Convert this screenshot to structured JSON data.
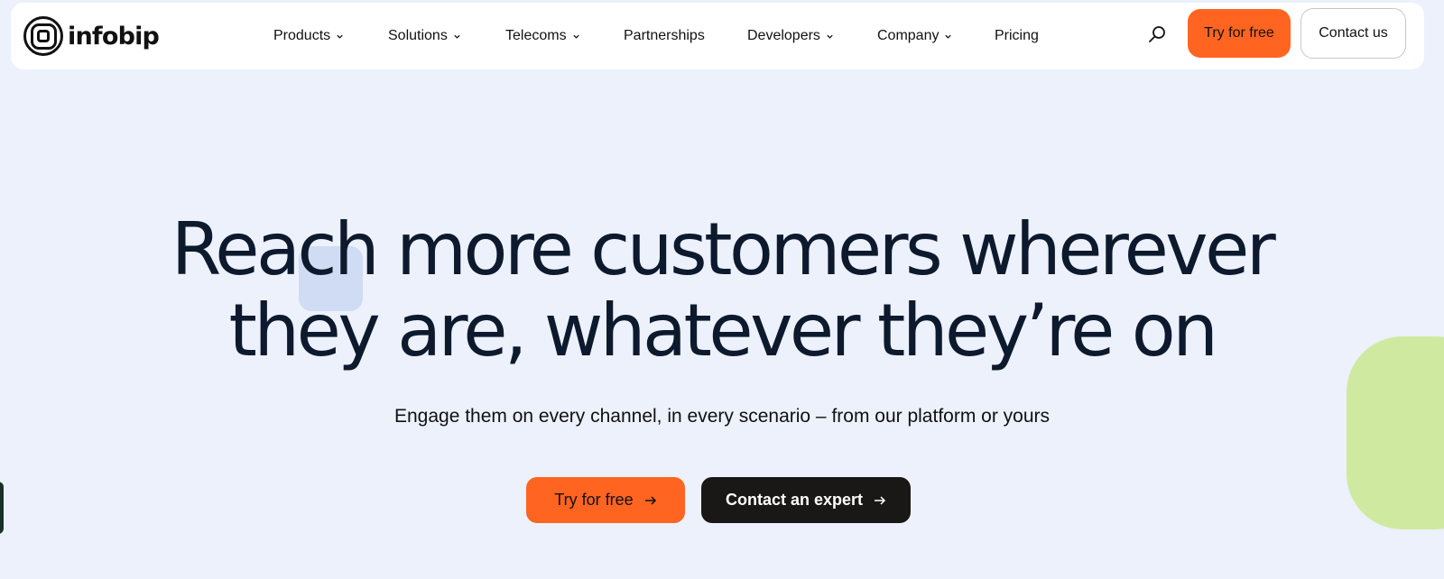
{
  "brand": {
    "name": "infobip"
  },
  "nav": {
    "items": [
      {
        "label": "Products",
        "has_dropdown": true
      },
      {
        "label": "Solutions",
        "has_dropdown": true
      },
      {
        "label": "Telecoms",
        "has_dropdown": true
      },
      {
        "label": "Partnerships",
        "has_dropdown": false
      },
      {
        "label": "Developers",
        "has_dropdown": true
      },
      {
        "label": "Company",
        "has_dropdown": true
      },
      {
        "label": "Pricing",
        "has_dropdown": false
      }
    ],
    "search_icon": "search-icon",
    "try_label": "Try for free",
    "contact_label": "Contact us"
  },
  "hero": {
    "title_line1": "Reach more customers wherever",
    "title_line2": "they are, whatever they’re on",
    "subtitle": "Engage them on every channel, in every scenario – from our platform or yours",
    "cta_primary": "Try for free",
    "cta_secondary": "Contact an expert"
  },
  "colors": {
    "page_background": "#ecf1fc",
    "accent_orange": "#ff6520",
    "dark_button": "#1a1817",
    "decor_green": "#cfeaa0",
    "decor_blue": "#cfdcf3"
  }
}
